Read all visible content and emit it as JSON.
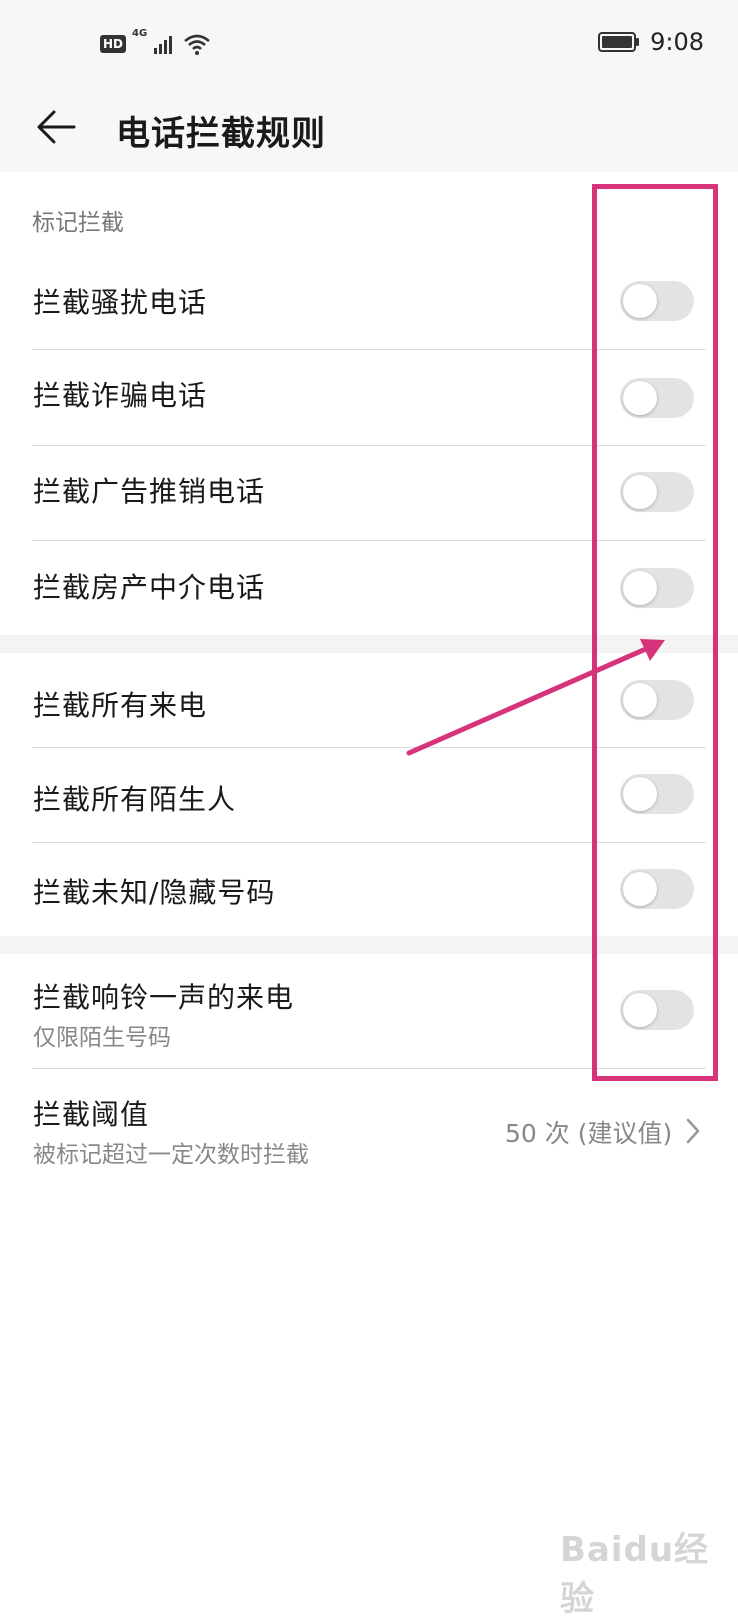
{
  "status_bar": {
    "hd_badge": "HD",
    "network": "4G",
    "time": "9:08"
  },
  "header": {
    "title": "电话拦截规则",
    "back_icon": "arrow-left-icon"
  },
  "section_marked": {
    "title": "标记拦截",
    "items": [
      {
        "label": "拦截骚扰电话",
        "enabled": false
      },
      {
        "label": "拦截诈骗电话",
        "enabled": false
      },
      {
        "label": "拦截广告推销电话",
        "enabled": false
      },
      {
        "label": "拦截房产中介电话",
        "enabled": false
      }
    ]
  },
  "section_general": {
    "items": [
      {
        "label": "拦截所有来电",
        "enabled": false
      },
      {
        "label": "拦截所有陌生人",
        "enabled": false
      },
      {
        "label": "拦截未知/隐藏号码",
        "enabled": false
      }
    ]
  },
  "section_other": {
    "ring_once": {
      "label": "拦截响铃一声的来电",
      "sublabel": "仅限陌生号码",
      "enabled": false
    },
    "threshold": {
      "label": "拦截阈值",
      "sublabel": "被标记超过一定次数时拦截",
      "value": "50 次 (建议值)"
    }
  },
  "annotation": {
    "color": "#d6337a"
  },
  "watermark": {
    "text": "Baidu经验"
  }
}
